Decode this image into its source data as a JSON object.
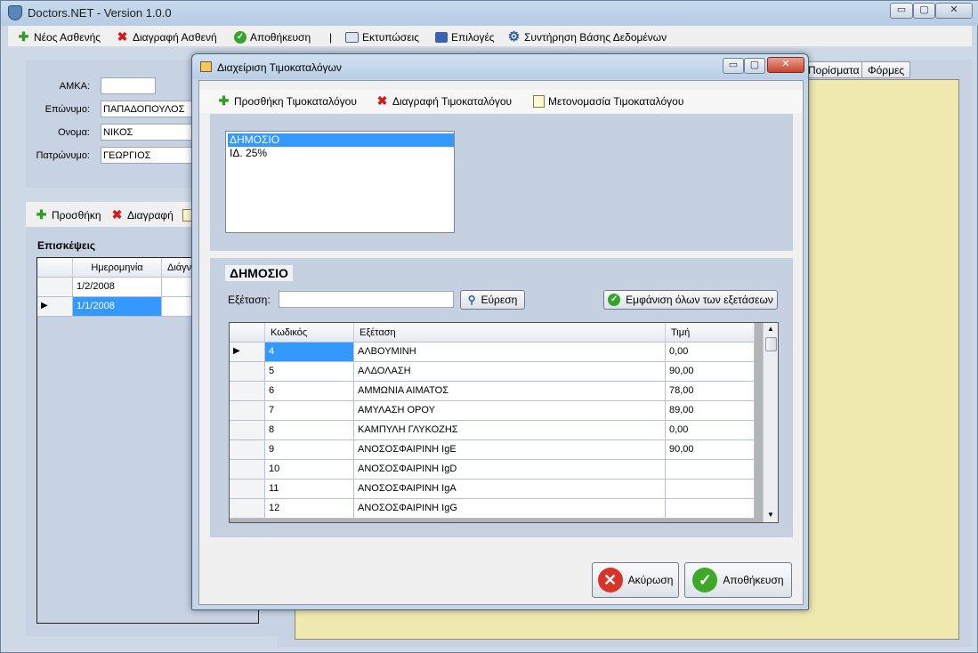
{
  "main": {
    "title": "Doctors.NET - Version 1.0.0",
    "caption_buttons": [
      "▭",
      "▢",
      "✕"
    ],
    "menu": [
      {
        "label": "Νέος Ασθενής",
        "icon": "plus-icon"
      },
      {
        "label": "Διαγραφή Ασθενή",
        "icon": "delete-icon"
      },
      {
        "label": "Αποθήκευση",
        "icon": "check-icon"
      },
      {
        "label": "|"
      },
      {
        "label": "Εκτυπώσεις",
        "icon": "printer-icon"
      },
      {
        "label": "Επιλογές",
        "icon": "options-icon"
      },
      {
        "label": "Συντήρηση Βάσης Δεδομένων",
        "icon": "gear-icon"
      }
    ]
  },
  "patient": {
    "amka_label": "ΑΜΚΑ:",
    "amka_value": "",
    "surname_label": "Επώνυμο:",
    "surname_value": "ΠΑΠΑΔΟΠΟΥΛΟΣ",
    "name_label": "Ονομα:",
    "name_value": "ΝΙΚΟΣ",
    "father_label": "Πατρώνυμο:",
    "father_value": "ΓΕΩΡΓΙΟΣ"
  },
  "visits": {
    "toolbar": {
      "add_label": "Προσθήκη",
      "delete_label": "Διαγραφή"
    },
    "title": "Επισκέψεις",
    "columns": [
      "Ημερομηνία",
      "Διάγν"
    ],
    "rows": [
      {
        "date": "1/2/2008"
      },
      {
        "date": "1/1/2008"
      }
    ]
  },
  "tabs": [
    "Πορίσματα",
    "Φόρμες"
  ],
  "dialog": {
    "title": "Διαχείριση Τιμοκαταλόγων",
    "caption_buttons": [
      "▭",
      "▢",
      "✕"
    ],
    "toolbar": {
      "add_label": "Προσθήκη Τιμοκαταλόγου",
      "delete_label": "Διαγραφή Τιμοκαταλόγου",
      "rename_label": "Μετονομασία Τιμοκαταλόγου"
    },
    "pricelists": [
      "ΔΗΜΟΣΙΟ",
      "ΙΔ. 25%"
    ],
    "selected_pricelist": "ΔΗΜΟΣΙΟ",
    "exam_label": "Εξέταση:",
    "exam_value": "",
    "search_label": "Εύρεση",
    "show_all_label": "Εμφάνιση όλων των εξετάσεων",
    "grid": {
      "columns": [
        "Κωδικός",
        "Εξέταση",
        "Τιμή"
      ],
      "rows": [
        {
          "code": "4",
          "exam": "ΑΛΒΟΥΜΙΝΗ",
          "price": "0,00"
        },
        {
          "code": "5",
          "exam": "ΑΛΔΟΛΑΣΗ",
          "price": "90,00"
        },
        {
          "code": "6",
          "exam": "ΑΜΜΩΝΙΑ ΑΙΜΑΤΟΣ",
          "price": "78,00"
        },
        {
          "code": "7",
          "exam": "ΑΜΥΛΑΣΗ ΟΡΟΥ",
          "price": "89,00"
        },
        {
          "code": "8",
          "exam": "ΚΑΜΠΥΛΗ ΓΛΥΚΟΖΗΣ",
          "price": "0,00"
        },
        {
          "code": "9",
          "exam": "ΑΝΟΣΟΣΦΑΙΡΙΝΗ IgE",
          "price": "90,00"
        },
        {
          "code": "10",
          "exam": "ΑΝΟΣΟΣΦΑΙΡΙΝΗ IgD",
          "price": ""
        },
        {
          "code": "11",
          "exam": "ΑΝΟΣΟΣΦΑΙΡΙΝΗ IgA",
          "price": ""
        },
        {
          "code": "12",
          "exam": "ΑΝΟΣΟΣΦΑΙΡΙΝΗ IgG",
          "price": ""
        }
      ]
    },
    "cancel_label": "Ακύρωση",
    "save_label": "Αποθήκευση"
  }
}
